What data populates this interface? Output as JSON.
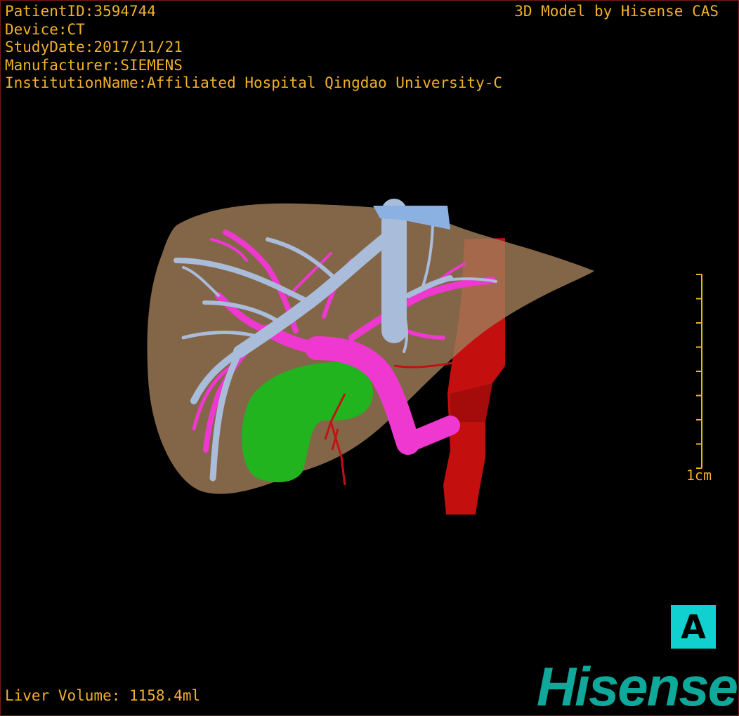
{
  "header": {
    "patient_id": "PatientID:3594744",
    "device": "Device:CT",
    "study_date": "StudyDate:2017/11/21",
    "manufacturer": "Manufacturer:SIEMENS",
    "institution": "InstitutionName:Affiliated Hospital Qingdao University-C",
    "brand_title": "3D Model by Hisense CAS"
  },
  "scale_bar": {
    "label": "1cm",
    "tick_count": 9
  },
  "footer": {
    "volume": "Liver Volume: 1158.4ml",
    "logo": "Hisense"
  },
  "orientation": {
    "letter": "A",
    "color": "#10d0d0"
  },
  "model": {
    "structures": [
      {
        "name": "liver",
        "color": "#a07c58"
      },
      {
        "name": "hepatic-veins",
        "color": "#a9bcd9"
      },
      {
        "name": "portal-vein",
        "color": "#ee38d0"
      },
      {
        "name": "gallbladder",
        "color": "#22b41e"
      },
      {
        "name": "aorta",
        "color": "#c40f0f"
      },
      {
        "name": "hepatic-artery",
        "color": "#c21212"
      }
    ]
  },
  "colors": {
    "text": "#f2b12a",
    "logo": "#0fa89a",
    "background": "#000000"
  }
}
